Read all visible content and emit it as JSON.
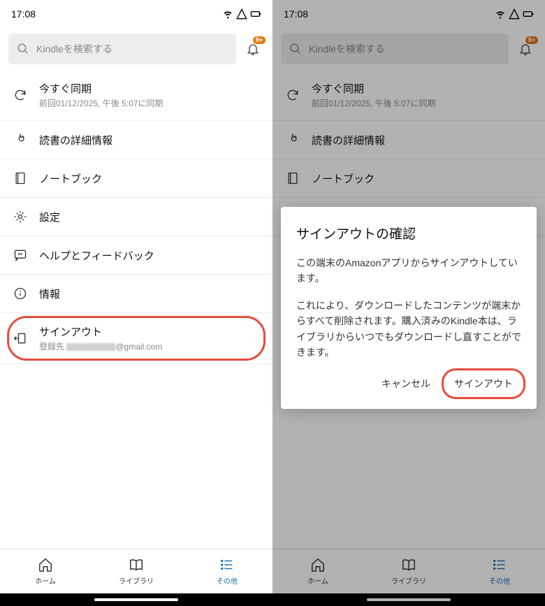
{
  "status": {
    "time": "17:08",
    "badge": "9+"
  },
  "search": {
    "placeholder": "Kindleを検索する"
  },
  "menu": {
    "sync": {
      "title": "今すぐ同期",
      "sub": "前回01/12/2025, 午後 5:07に同期"
    },
    "reading": {
      "title": "読書の詳細情報"
    },
    "notebook": {
      "title": "ノートブック"
    },
    "settings": {
      "title": "設定"
    },
    "help": {
      "title": "ヘルプとフィードバック"
    },
    "info": {
      "title": "情報"
    },
    "signout": {
      "title": "サインアウト",
      "sub_prefix": "登録先 ",
      "sub_suffix": "@gmail.com"
    }
  },
  "nav": {
    "home": "ホーム",
    "library": "ライブラリ",
    "more": "その他"
  },
  "dialog": {
    "title": "サインアウトの確認",
    "p1": "この端末のAmazonアプリからサインアウトしています。",
    "p2": "これにより、ダウンロードしたコンテンツが端末からすべて削除されます。購入済みのKindle本は、ライブラリからいつでもダウンロードし直すことができます。",
    "cancel": "キャンセル",
    "confirm": "サインアウト"
  }
}
